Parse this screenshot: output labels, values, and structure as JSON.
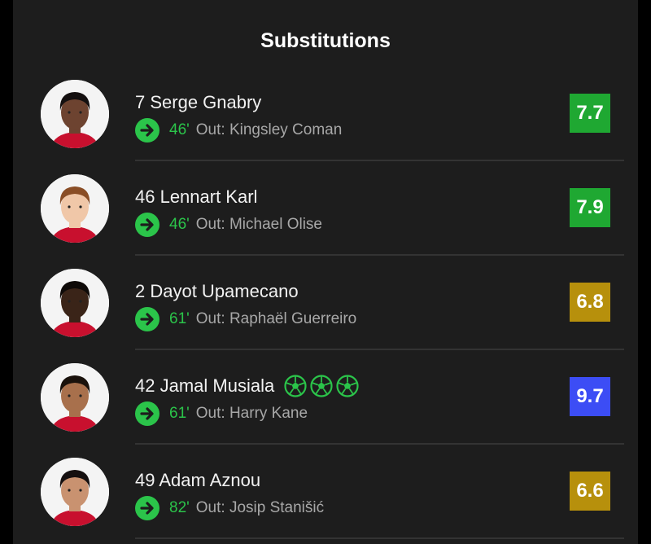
{
  "header": {
    "title": "Substitutions"
  },
  "players": [
    {
      "name": "7 Serge Gnabry",
      "minute": "46'",
      "out": "Out: Kingsley Coman",
      "rating": "7.7",
      "rating_color": "#1fa832",
      "goals": 0,
      "skin": "#6d4330",
      "hair": "#141010"
    },
    {
      "name": "46 Lennart Karl",
      "minute": "46'",
      "out": "Out: Michael Olise",
      "rating": "7.9",
      "rating_color": "#1fa832",
      "goals": 0,
      "skin": "#f0c7a8",
      "hair": "#8a4e26"
    },
    {
      "name": "2 Dayot Upamecano",
      "minute": "61'",
      "out": "Out: Raphaël Guerreiro",
      "rating": "6.8",
      "rating_color": "#b7900c",
      "goals": 0,
      "skin": "#3a2418",
      "hair": "#0e0a08"
    },
    {
      "name": "42 Jamal Musiala",
      "minute": "61'",
      "out": "Out: Harry Kane",
      "rating": "9.7",
      "rating_color": "#3c4df5",
      "goals": 3,
      "skin": "#a8704c",
      "hair": "#1a120c"
    },
    {
      "name": "49 Adam Aznou",
      "minute": "82'",
      "out": "Out: Josip Stanišić",
      "rating": "6.6",
      "rating_color": "#b7900c",
      "goals": 0,
      "skin": "#c99270",
      "hair": "#151010"
    }
  ],
  "icons": {
    "substitution": "arrow-right-circle-icon",
    "goal": "soccer-ball-icon"
  },
  "colors": {
    "background": "#1d1d1d",
    "minute": "#2bc44a",
    "divider": "#333333"
  }
}
